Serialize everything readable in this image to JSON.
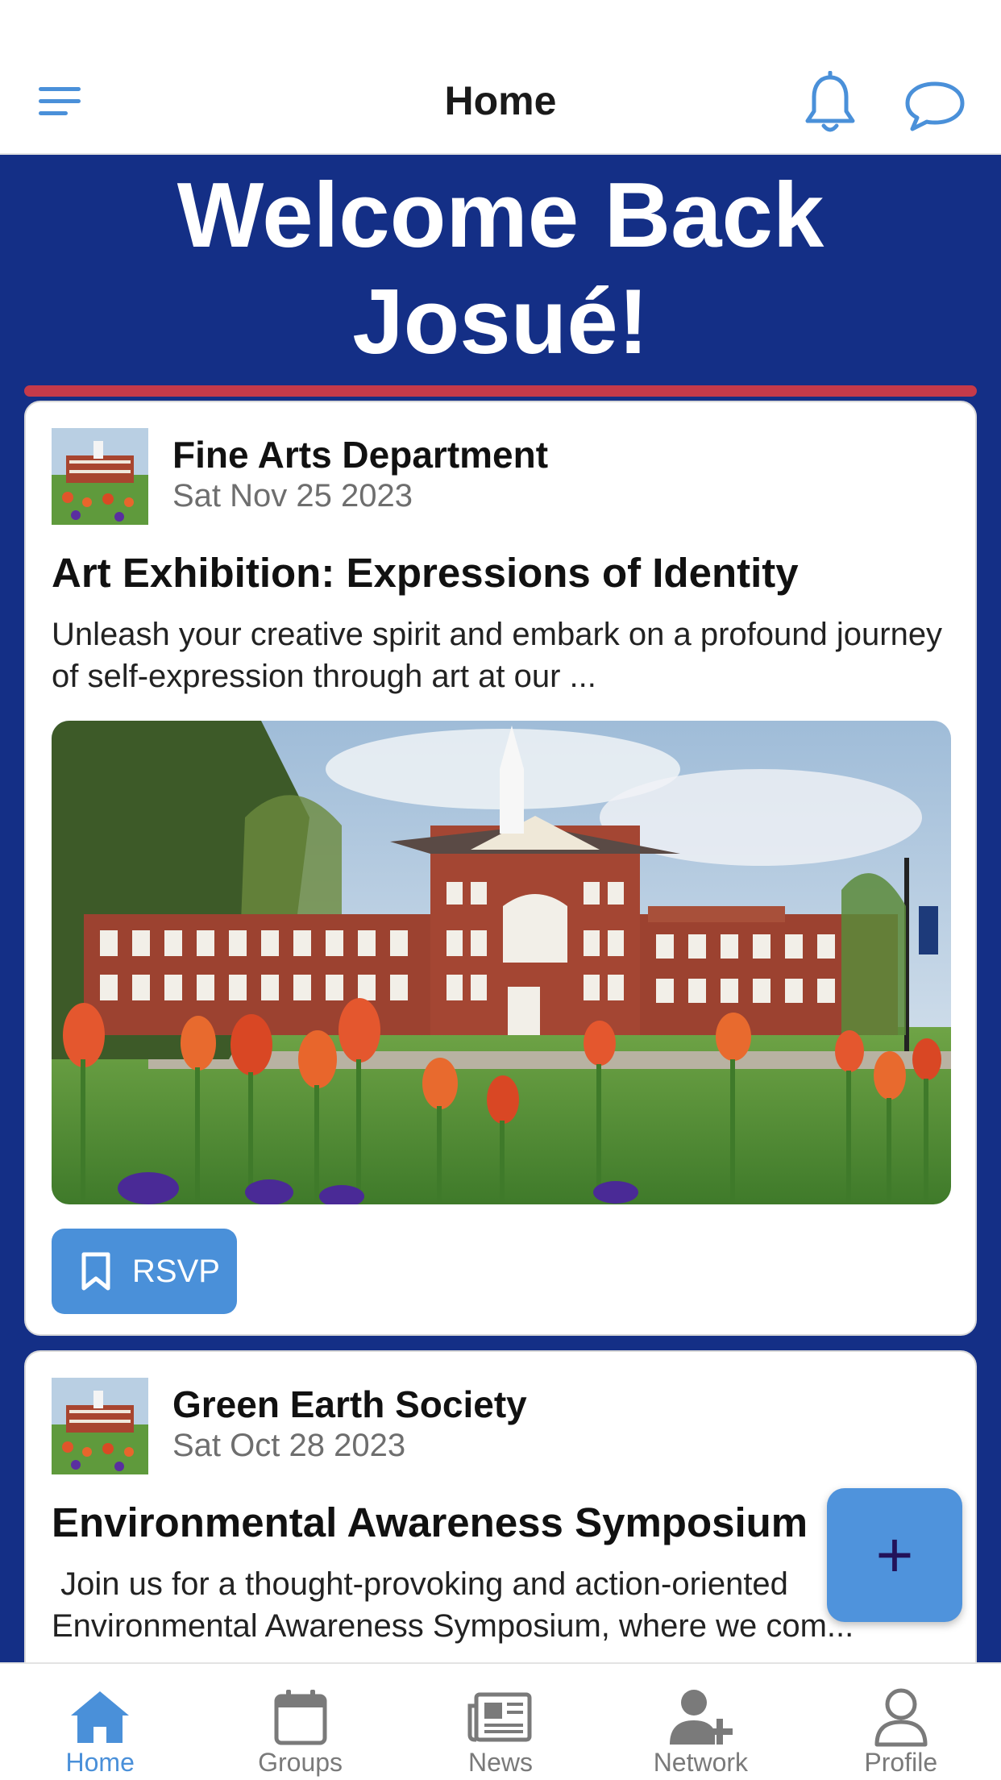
{
  "header": {
    "title": "Home",
    "menu_icon": "hamburger-menu-icon",
    "notification_icon": "bell-icon",
    "messages_icon": "chat-bubble-icon"
  },
  "welcome": {
    "line1": "Welcome Back",
    "line2": "Josué!"
  },
  "posts": [
    {
      "organization": "Fine Arts Department",
      "date": "Sat Nov 25 2023",
      "title": "Art Exhibition: Expressions of Identity",
      "description": "Unleash your creative spirit and embark on a profound journey of self-expression through art at our ...",
      "rsvp_label": "RSVP",
      "rsvp_icon": "bookmark-icon"
    },
    {
      "organization": "Green Earth Society",
      "date": "Sat Oct 28 2023",
      "title": "Environmental Awareness Symposium",
      "description": " Join us for a thought-provoking and action-oriented Environmental Awareness Symposium, where we com..."
    }
  ],
  "fab": {
    "label": "+"
  },
  "tabs": [
    {
      "label": "Home",
      "icon": "home-icon",
      "active": true
    },
    {
      "label": "Groups",
      "icon": "calendar-icon",
      "active": false
    },
    {
      "label": "News",
      "icon": "newspaper-icon",
      "active": false
    },
    {
      "label": "Network",
      "icon": "add-user-icon",
      "active": false
    },
    {
      "label": "Profile",
      "icon": "person-icon",
      "active": false
    }
  ],
  "colors": {
    "banner": "#142f86",
    "accent_red": "#c53a4a",
    "primary_blue": "#4a90d9",
    "fab_plus": "#22125a",
    "inactive_tab": "#7a7a7a"
  }
}
